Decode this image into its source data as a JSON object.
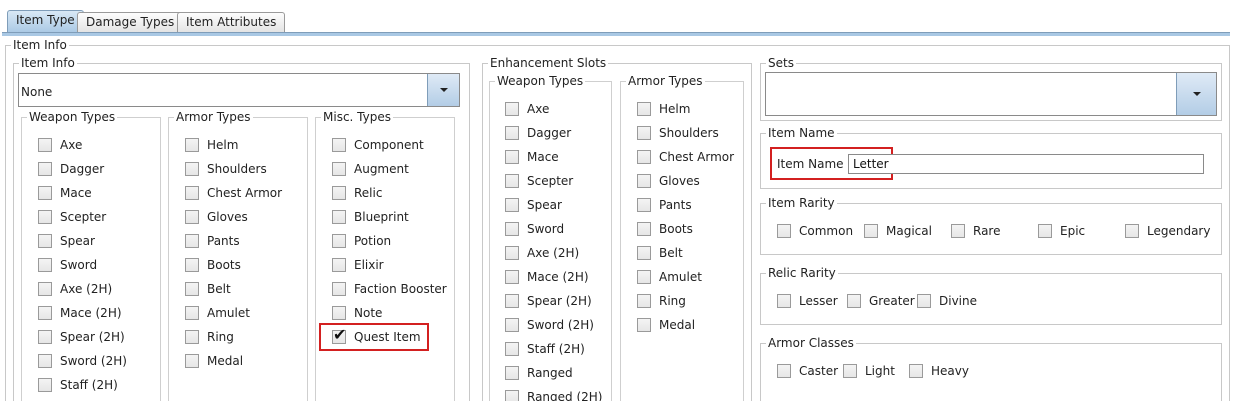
{
  "tabs": [
    {
      "label": "Item Type",
      "active": true
    },
    {
      "label": "Damage Types",
      "active": false
    },
    {
      "label": "Item Attributes",
      "active": false
    }
  ],
  "item_info_outer": {
    "legend": "Item Info"
  },
  "item_info": {
    "legend": "Item Info",
    "combo_value": "None",
    "weapon_types": {
      "legend": "Weapon Types",
      "items": [
        "Axe",
        "Dagger",
        "Mace",
        "Scepter",
        "Spear",
        "Sword",
        "Axe (2H)",
        "Mace (2H)",
        "Spear (2H)",
        "Sword (2H)",
        "Staff (2H)"
      ]
    },
    "armor_types": {
      "legend": "Armor Types",
      "items": [
        "Helm",
        "Shoulders",
        "Chest Armor",
        "Gloves",
        "Pants",
        "Boots",
        "Belt",
        "Amulet",
        "Ring",
        "Medal"
      ]
    },
    "misc_types": {
      "legend": "Misc. Types",
      "items": [
        "Component",
        "Augment",
        "Relic",
        "Blueprint",
        "Potion",
        "Elixir",
        "Faction Booster",
        "Note",
        "Quest Item"
      ],
      "checked": "Quest Item"
    }
  },
  "enhancement_slots": {
    "legend": "Enhancement Slots",
    "weapon_types": {
      "legend": "Weapon Types",
      "items": [
        "Axe",
        "Dagger",
        "Mace",
        "Scepter",
        "Spear",
        "Sword",
        "Axe (2H)",
        "Mace (2H)",
        "Spear (2H)",
        "Sword (2H)",
        "Staff (2H)",
        "Ranged",
        "Ranged (2H)"
      ]
    },
    "armor_types": {
      "legend": "Armor Types",
      "items": [
        "Helm",
        "Shoulders",
        "Chest Armor",
        "Gloves",
        "Pants",
        "Boots",
        "Belt",
        "Amulet",
        "Ring",
        "Medal"
      ]
    }
  },
  "sets": {
    "legend": "Sets",
    "value": ""
  },
  "item_name": {
    "legend": "Item Name",
    "label": "Item Name",
    "value": "Letter"
  },
  "item_rarity": {
    "legend": "Item Rarity",
    "items": [
      "Common",
      "Magical",
      "Rare",
      "Epic",
      "Legendary"
    ]
  },
  "relic_rarity": {
    "legend": "Relic Rarity",
    "items": [
      "Lesser",
      "Greater",
      "Divine"
    ]
  },
  "armor_classes": {
    "legend": "Armor Classes",
    "items": [
      "Caster",
      "Light",
      "Heavy"
    ]
  },
  "colors": {
    "tab_active": "#a9c8e4",
    "highlight": "#d32020"
  }
}
